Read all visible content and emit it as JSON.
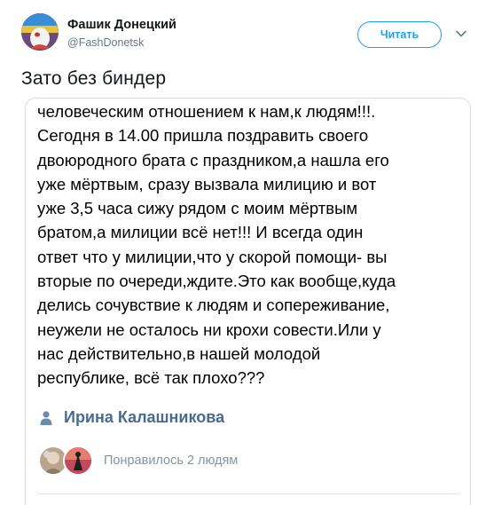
{
  "account": {
    "name": "Фашик Донецкий",
    "handle": "@FashDonetsk",
    "follow_label": "Читать"
  },
  "tweet": {
    "text": "Зато без биндер"
  },
  "embedded_post": {
    "body": "человеческим отношением к нам,к людям!!!.\nСегодня в 14.00 пришла поздравить своего\nдвоюродного брата с праздником,а нашла его\nуже мёртвым, сразу вызвала милицию и вот\nуже 3,5 часа сижу рядом с моим мёртвым\nбратом,а милиции всё нет!!! И всегда один\nответ что у милиции,что у скорой помощи- вы\nвторые по очереди,ждите.Это как вообще,куда\nделись сочувствие к людям и сопереживание,\nнеужели не осталось ни крохи совести.Или у\nнас действительно,в нашей молодой\nреспублике, всё так плохо???",
    "author": "Ирина Калашникова",
    "likes_text": "Понравилось 2 людям"
  },
  "colors": {
    "accent": "#1da1f2",
    "author_link": "#4a6a8f",
    "muted": "#657786"
  },
  "icons": [
    "avatar",
    "chevron-down-icon",
    "person-icon"
  ]
}
